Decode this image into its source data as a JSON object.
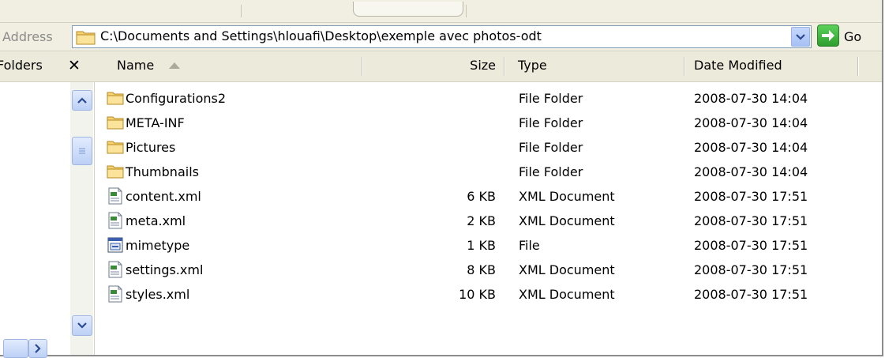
{
  "address": {
    "label": "Address",
    "path": "C:\\Documents and Settings\\hlouafi\\Desktop\\exemple avec photos-odt",
    "go_label": "Go"
  },
  "folders_pane": {
    "title": "Folders"
  },
  "columns": {
    "name": "Name",
    "size": "Size",
    "type": "Type",
    "date": "Date Modified"
  },
  "files": [
    {
      "name": "Configurations2",
      "size": "",
      "type": "File Folder",
      "date": "2008-07-30 14:04",
      "icon": "folder-icon"
    },
    {
      "name": "META-INF",
      "size": "",
      "type": "File Folder",
      "date": "2008-07-30 14:04",
      "icon": "folder-icon"
    },
    {
      "name": "Pictures",
      "size": "",
      "type": "File Folder",
      "date": "2008-07-30 14:04",
      "icon": "folder-icon"
    },
    {
      "name": "Thumbnails",
      "size": "",
      "type": "File Folder",
      "date": "2008-07-30 14:04",
      "icon": "folder-icon"
    },
    {
      "name": "content.xml",
      "size": "6 KB",
      "type": "XML Document",
      "date": "2008-07-30 17:51",
      "icon": "xml-file-icon"
    },
    {
      "name": "meta.xml",
      "size": "2 KB",
      "type": "XML Document",
      "date": "2008-07-30 17:51",
      "icon": "xml-file-icon"
    },
    {
      "name": "mimetype",
      "size": "1 KB",
      "type": "File",
      "date": "2008-07-30 17:51",
      "icon": "generic-file-icon"
    },
    {
      "name": "settings.xml",
      "size": "8 KB",
      "type": "XML Document",
      "date": "2008-07-30 17:51",
      "icon": "xml-file-icon"
    },
    {
      "name": "styles.xml",
      "size": "10 KB",
      "type": "XML Document",
      "date": "2008-07-30 17:51",
      "icon": "xml-file-icon"
    }
  ],
  "colors": {
    "chrome": "#f1efe2",
    "header": "#ebeadb",
    "accent_blue": "#7f9db9",
    "go_green": "#2e9e2e"
  }
}
